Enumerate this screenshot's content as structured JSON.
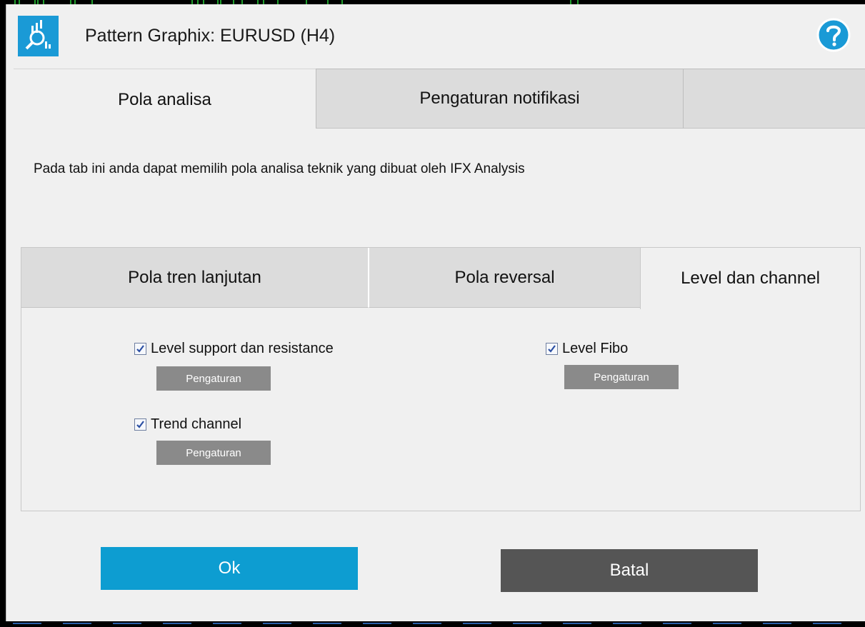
{
  "window": {
    "title": "Pattern Graphix: EURUSD (H4)",
    "logo_icon": "chart-magnifier-icon",
    "help_icon": "question-mark-icon"
  },
  "main_tabs": [
    {
      "label": "Pola analisa",
      "active": true
    },
    {
      "label": "Pengaturan notifikasi",
      "active": false
    },
    {
      "label": "",
      "active": false
    }
  ],
  "description": "Pada tab ini anda dapat memilih pola analisa teknik yang dibuat oleh IFX Analysis",
  "sub_tabs": [
    {
      "label": "Pola tren lanjutan",
      "active": false
    },
    {
      "label": "Pola reversal",
      "active": false
    },
    {
      "label": "Level dan channel",
      "active": true
    }
  ],
  "options": [
    {
      "label": "Level support dan resistance",
      "checked": true,
      "settings_label": "Pengaturan"
    },
    {
      "label": "Trend channel",
      "checked": true,
      "settings_label": "Pengaturan"
    },
    {
      "label": "Level Fibo",
      "checked": true,
      "settings_label": "Pengaturan"
    }
  ],
  "buttons": {
    "ok_label": "Ok",
    "cancel_label": "Batal"
  },
  "colors": {
    "accent": "#0d9dd1",
    "cancel": "#555555",
    "settings_button": "#8a8a8a",
    "logo_bg": "#1a9ad6"
  }
}
